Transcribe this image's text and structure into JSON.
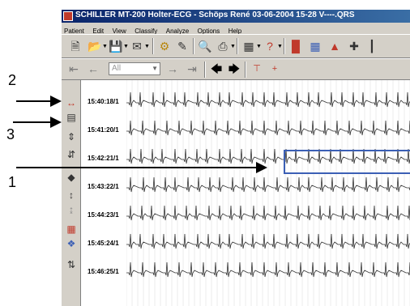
{
  "window_title": "SCHILLER MT-200 Holter-ECG - Schöps René 03-06-2004 15-28 V----.QRS",
  "menu": [
    "Patient",
    "Edit",
    "View",
    "Classify",
    "Analyze",
    "Options",
    "Help"
  ],
  "toolbar2": {
    "filter_placeholder": "All"
  },
  "callouts": [
    "2",
    "3",
    "1"
  ],
  "ecg_times": [
    "15:40:18/1",
    "15:41:20/1",
    "15:42:21/1",
    "15:43:22/1",
    "15:44:23/1",
    "15:45:24/1",
    "15:46:25/1"
  ],
  "colors": {
    "title_bar": "#0a246a",
    "selection": "#3b5fb5",
    "ecg_trace": "#333333",
    "ecg_grid": "#d8d8d8"
  },
  "icons": {
    "toolbar1": [
      "new-document-icon",
      "open-folder-icon",
      "save-icon",
      "email-icon",
      "user-settings-icon",
      "edit-icon",
      "print-preview-icon",
      "print-icon",
      "network-icon",
      "help-icon",
      "24h-trend-icon",
      "table-icon",
      "hr-trend-icon",
      "ecg-grid-icon"
    ],
    "toolbar2": [
      "first-icon",
      "back-icon",
      "forward-icon",
      "last-icon",
      "prev-event-icon",
      "next-event-icon",
      "marker-icon",
      "marker-add-icon"
    ],
    "vstrip": [
      "line-tool-icon",
      "stack-icon",
      "expand-vertical-icon",
      "compress-icon",
      "spread-icon",
      "ruler-icon",
      "jump-icon",
      "markers-icon",
      "adjust-icon",
      "list-icon"
    ]
  }
}
